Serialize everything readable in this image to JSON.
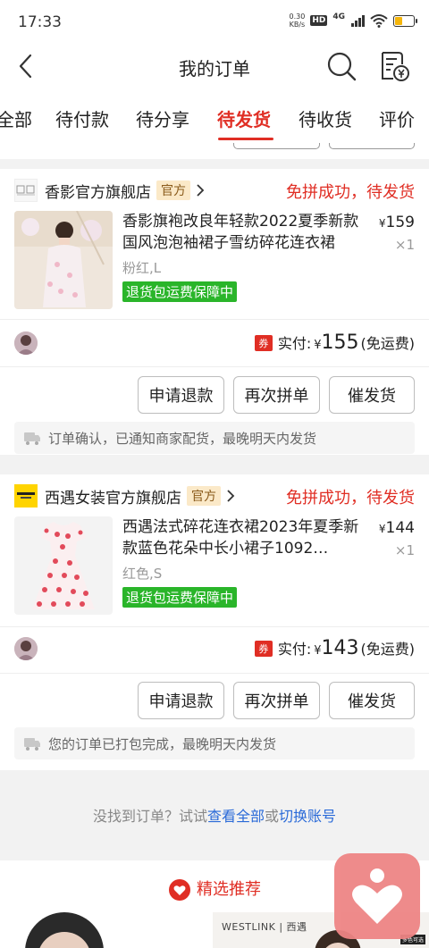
{
  "status_bar": {
    "time": "17:33",
    "net_speed_value": "0.30",
    "net_speed_unit": "KB/s",
    "hd_label": "HD",
    "network_label": "4G",
    "battery_level_percent": 40
  },
  "nav": {
    "title": "我的订单",
    "back_icon": "chevron-left-icon",
    "search_icon": "search-icon",
    "invoice_icon": "invoice-yen-icon"
  },
  "tabs": [
    {
      "label": "全部",
      "active": false
    },
    {
      "label": "待付款",
      "active": false
    },
    {
      "label": "待分享",
      "active": false
    },
    {
      "label": "待发货",
      "active": true
    },
    {
      "label": "待收货",
      "active": false
    },
    {
      "label": "评价",
      "active": false
    }
  ],
  "orders": [
    {
      "shop_name": "香影官方旗舰店",
      "shop_tag": "官方",
      "status": "免拼成功，待发货",
      "product_title": "香影旗袍改良年轻款2022夏季新款国风泡泡袖裙子雪纺碎花连衣裙",
      "price_symbol": "¥",
      "price": "159",
      "quantity": "×1",
      "spec": "粉红,L",
      "badge": "退货包运费保障中",
      "coupon_label": "券",
      "paid_label": "实付:",
      "paid_symbol": "¥",
      "paid_amount": "155",
      "shipping_note": "(免运费)",
      "buttons": [
        "申请退款",
        "再次拼单",
        "催发货"
      ],
      "notice": "订单确认，已通知商家配货，最晚明天内发货"
    },
    {
      "shop_name": "西遇女装官方旗舰店",
      "shop_tag": "官方",
      "status": "免拼成功，待发货",
      "product_title": "西遇法式碎花连衣裙2023年夏季新款蓝色花朵中长小裙子1092…",
      "price_symbol": "¥",
      "price": "144",
      "quantity": "×1",
      "spec": "红色,S",
      "badge": "退货包运费保障中",
      "coupon_label": "券",
      "paid_label": "实付:",
      "paid_symbol": "¥",
      "paid_amount": "143",
      "shipping_note": "(免运费)",
      "buttons": [
        "申请退款",
        "再次拼单",
        "催发货"
      ],
      "notice": "您的订单已打包完成，最晚明天内发货"
    }
  ],
  "footer": {
    "hint_prefix": "没找到订单？试试",
    "link_all": "查看全部",
    "or_text": "或",
    "link_switch": "切换账号"
  },
  "recommend": {
    "title": "精选推荐",
    "brand_text": "WESTLINK | 西遇",
    "corner_tag": "多色可选"
  },
  "colors": {
    "accent_red": "#e02e24",
    "badge_green": "#2ab52a",
    "link_blue": "#2a6ad8",
    "tag_bg": "#fbe9c8"
  }
}
